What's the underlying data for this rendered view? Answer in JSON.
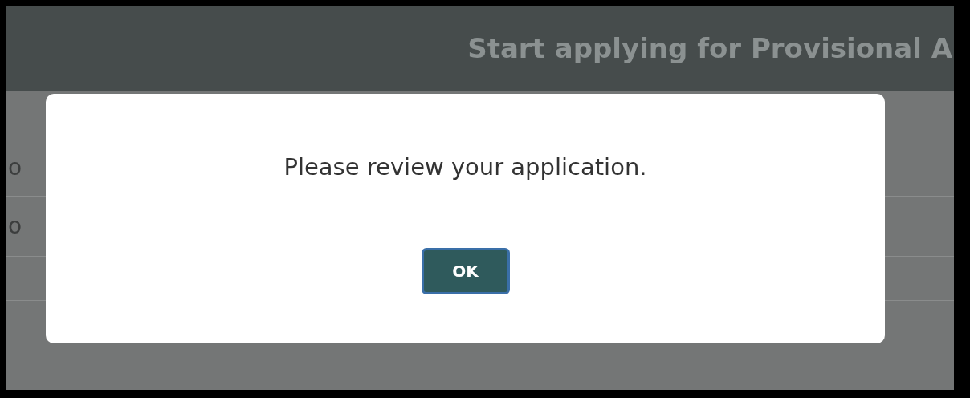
{
  "header": {
    "title": "Start applying for Provisional A"
  },
  "background_rows": [
    {
      "label": "o"
    },
    {
      "label": "o"
    },
    {
      "label": ""
    }
  ],
  "dialog": {
    "message": "Please review your application.",
    "buttons": [
      "OK"
    ]
  }
}
